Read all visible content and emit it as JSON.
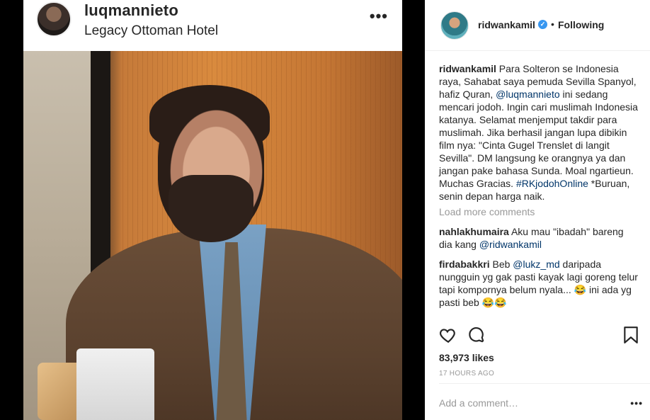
{
  "original_post": {
    "username": "luqmannieto",
    "location": "Legacy Ottoman Hotel",
    "more_label": "•••"
  },
  "repost": {
    "username": "ridwankamil",
    "verified_mark": "✓",
    "separator": "•",
    "following_label": "Following",
    "caption_username": "ridwankamil",
    "caption_part1": " Para Solteron se Indonesia raya, Sahabat saya pemuda Sevilla Spanyol, hafiz Quran, ",
    "caption_mention": "@luqmannieto",
    "caption_part2": " ini sedang mencari jodoh. Ingin cari muslimah Indonesia katanya. Selamat menjemput takdir para muslimah. Jika berhasil jangan lupa dibikin film nya: \"Cinta Gugel Trenslet di langit Sevilla\". DM langsung ke orangnya ya dan jangan pake bahasa Sunda. Moal ngartieun. Muchas Gracias. ",
    "caption_hashtag": "#RKjodohOnline",
    "caption_part3": " *Buruan, senin depan harga naik.",
    "load_more": "Load more comments",
    "comments": [
      {
        "username": "nahlakhumaira",
        "text_part1": " Aku mau \"ibadah\" bareng dia kang ",
        "mention": "@ridwankamil",
        "text_part2": ""
      },
      {
        "username": "firdabakkri",
        "text_part1": " Beb ",
        "mention": "@lukz_md",
        "text_part2": " daripada nungguin yg gak pasti kayak lagi goreng telur tapi kompornya belum nyala... 😂 ini ada yg pasti beb 😂😂"
      }
    ],
    "likes": "83,973 likes",
    "time_ago": "17 HOURS AGO",
    "add_comment_placeholder": "Add a comment…",
    "more_label": "•••"
  },
  "colors": {
    "link": "#003569",
    "muted": "#999999",
    "verified": "#3897f0",
    "text": "#262626"
  },
  "icons": [
    "more-icon",
    "verified-icon",
    "heart-icon",
    "comment-icon",
    "bookmark-icon"
  ]
}
